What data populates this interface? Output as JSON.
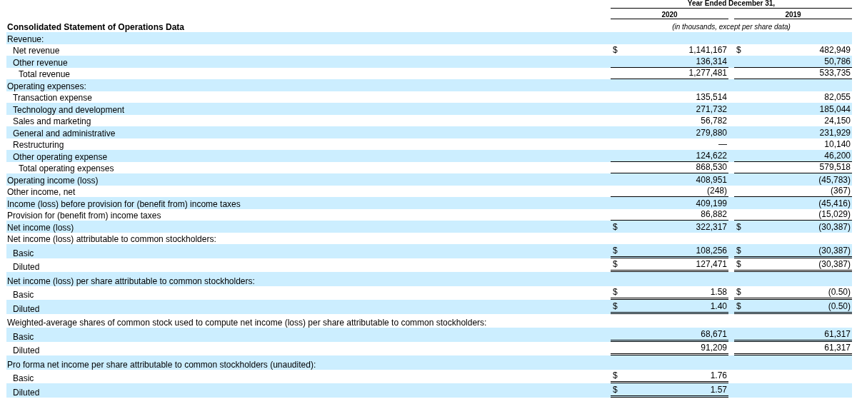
{
  "header": {
    "period": "Year Ended December 31,",
    "years": [
      "2020",
      "2019"
    ],
    "note": "(in thousands, except per share data)"
  },
  "table": {
    "title": "Consolidated Statement of Operations Data",
    "rows": [
      {
        "label": "Revenue:",
        "children": [
          {
            "label": "Net revenue",
            "values": [
              {
                "currency": "$",
                "amount": "1,141,167"
              },
              {
                "currency": "$",
                "amount": "482,949"
              }
            ]
          },
          {
            "label": "Other revenue",
            "values": [
              {
                "amount": "136,314",
                "single_rule": true
              },
              {
                "amount": "50,786",
                "single_rule": true
              }
            ]
          },
          {
            "label": "Total revenue",
            "kind": "total",
            "values": [
              {
                "amount": "1,277,481",
                "single_rule": true
              },
              {
                "amount": "533,735",
                "single_rule": true
              }
            ]
          }
        ]
      },
      {
        "label": "Operating expenses:",
        "children": [
          {
            "label": "Transaction expense",
            "values": [
              {
                "amount": "135,514"
              },
              {
                "amount": "82,055"
              }
            ]
          },
          {
            "label": "Technology and development",
            "values": [
              {
                "amount": "271,732"
              },
              {
                "amount": "185,044"
              }
            ]
          },
          {
            "label": "Sales and marketing",
            "values": [
              {
                "amount": "56,782"
              },
              {
                "amount": "24,150"
              }
            ]
          },
          {
            "label": "General and administrative",
            "values": [
              {
                "amount": "279,880"
              },
              {
                "amount": "231,929"
              }
            ]
          },
          {
            "label": "Restructuring",
            "values": [
              {
                "amount": "—"
              },
              {
                "amount": "10,140"
              }
            ]
          },
          {
            "label": "Other operating expense",
            "values": [
              {
                "amount": "124,622",
                "single_rule": true
              },
              {
                "amount": "46,200",
                "single_rule": true
              }
            ]
          },
          {
            "label": "Total operating expenses",
            "kind": "total",
            "values": [
              {
                "amount": "868,530",
                "single_rule": true
              },
              {
                "amount": "579,518",
                "single_rule": true
              }
            ]
          }
        ]
      },
      {
        "label": "Operating income (loss)",
        "values": [
          {
            "amount": "408,951"
          },
          {
            "amount": "(45,783)"
          }
        ]
      },
      {
        "label": "Other income, net",
        "values": [
          {
            "amount": "(248)",
            "single_rule": true
          },
          {
            "amount": "(367)",
            "single_rule": true
          }
        ]
      },
      {
        "label": "Income (loss) before provision for (benefit from) income taxes",
        "values": [
          {
            "amount": "409,199"
          },
          {
            "amount": "(45,416)"
          }
        ]
      },
      {
        "label": "Provision for (benefit from) income taxes",
        "values": [
          {
            "amount": "86,882",
            "single_rule": true
          },
          {
            "amount": "(15,029)",
            "single_rule": true
          }
        ]
      },
      {
        "label": "Net income (loss)",
        "values": [
          {
            "currency": "$",
            "amount": "322,317"
          },
          {
            "currency": "$",
            "amount": "(30,387)"
          }
        ]
      },
      {
        "label": "Net income (loss) attributable to common stockholders:",
        "children": [
          {
            "label": "Basic",
            "values": [
              {
                "currency": "$",
                "amount": "108,256",
                "double_rule": true
              },
              {
                "currency": "$",
                "amount": "(30,387)",
                "double_rule": true
              }
            ]
          },
          {
            "label": "Diluted",
            "values": [
              {
                "currency": "$",
                "amount": "127,471",
                "double_rule": true
              },
              {
                "currency": "$",
                "amount": "(30,387)",
                "double_rule": true
              }
            ]
          }
        ]
      },
      {
        "label": "Net income (loss) per share attributable to common stockholders:",
        "children": [
          {
            "label": "Basic",
            "values": [
              {
                "currency": "$",
                "amount": "1.58",
                "double_rule": true
              },
              {
                "currency": "$",
                "amount": "(0.50)",
                "double_rule": true
              }
            ]
          },
          {
            "label": "Diluted",
            "values": [
              {
                "currency": "$",
                "amount": "1.40",
                "double_rule": true
              },
              {
                "currency": "$",
                "amount": "(0.50)",
                "double_rule": true
              }
            ]
          }
        ]
      },
      {
        "label": "Weighted-average shares of common stock used to compute net income (loss) per share attributable to common stockholders:",
        "children": [
          {
            "label": "Basic",
            "values": [
              {
                "amount": "68,671",
                "double_rule": true
              },
              {
                "amount": "61,317",
                "double_rule": true
              }
            ]
          },
          {
            "label": "Diluted",
            "values": [
              {
                "amount": "91,209",
                "double_rule": true
              },
              {
                "amount": "61,317",
                "double_rule": true
              }
            ]
          }
        ]
      },
      {
        "label": "Pro forma net income per share attributable to common stockholders (unaudited):",
        "children": [
          {
            "label": "Basic",
            "values": [
              {
                "currency": "$",
                "amount": "1.76",
                "double_rule": true
              }
            ]
          },
          {
            "label": "Diluted",
            "values": [
              {
                "currency": "$",
                "amount": "1.57",
                "double_rule": true
              }
            ]
          }
        ]
      }
    ]
  }
}
